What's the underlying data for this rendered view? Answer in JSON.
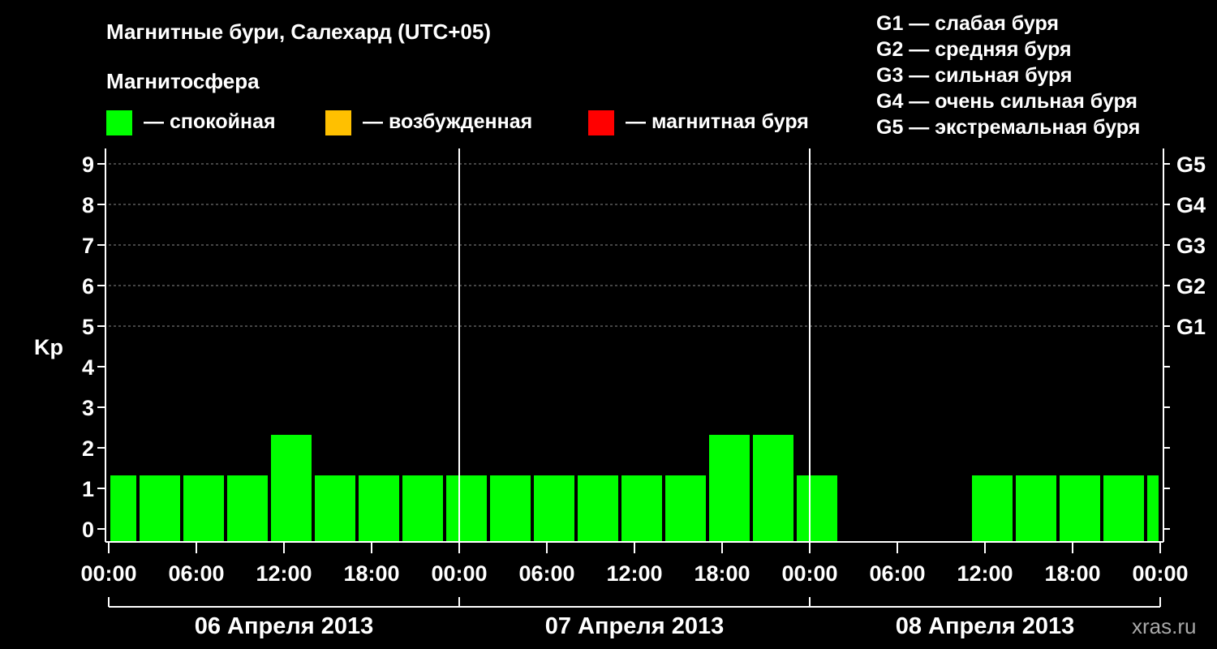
{
  "title": "Магнитные бури, Салехард (UTC+05)",
  "legend": {
    "heading": "Магнитосфера",
    "items": [
      {
        "key": "quiet",
        "label": "— спокойная",
        "color": "#00ff00"
      },
      {
        "key": "disturbed",
        "label": "— возбужденная",
        "color": "#ffc000"
      },
      {
        "key": "storm",
        "label": "— магнитная буря",
        "color": "#ff0000"
      }
    ]
  },
  "g_scale": [
    {
      "level": "G1",
      "text": "G1 — слабая буря"
    },
    {
      "level": "G2",
      "text": "G2 — средняя буря"
    },
    {
      "level": "G3",
      "text": "G3 — сильная буря"
    },
    {
      "level": "G4",
      "text": "G4 — очень сильная буря"
    },
    {
      "level": "G5",
      "text": "G5 — экстремальная буря"
    }
  ],
  "source": "xras.ru",
  "chart_data": {
    "type": "bar",
    "ylabel": "Kp",
    "ylim": [
      0,
      9
    ],
    "yticks": [
      0,
      1,
      2,
      3,
      4,
      5,
      6,
      7,
      8,
      9
    ],
    "right_ticks": [
      {
        "kp": 5,
        "label": "G1"
      },
      {
        "kp": 6,
        "label": "G2"
      },
      {
        "kp": 7,
        "label": "G3"
      },
      {
        "kp": 8,
        "label": "G4"
      },
      {
        "kp": 9,
        "label": "G5"
      }
    ],
    "x_hours_range": [
      0,
      72
    ],
    "xtick_hours": [
      0,
      6,
      12,
      18,
      24,
      30,
      36,
      42,
      48,
      54,
      60,
      66,
      72
    ],
    "xtick_labels": [
      "00:00",
      "06:00",
      "12:00",
      "18:00",
      "00:00",
      "06:00",
      "12:00",
      "18:00",
      "00:00",
      "06:00",
      "12:00",
      "18:00",
      "00:00"
    ],
    "days": [
      {
        "label": "06 Апреля 2013",
        "start_hour": 0
      },
      {
        "label": "07 Апреля 2013",
        "start_hour": 24
      },
      {
        "label": "08 Апреля 2013",
        "start_hour": 48
      }
    ],
    "grid": "dashed horizontal at Kp 5-9",
    "bars": [
      {
        "start_hour": 0,
        "end_hour": 2,
        "kp": 1,
        "state": "quiet"
      },
      {
        "start_hour": 2,
        "end_hour": 5,
        "kp": 1,
        "state": "quiet"
      },
      {
        "start_hour": 5,
        "end_hour": 8,
        "kp": 1,
        "state": "quiet"
      },
      {
        "start_hour": 8,
        "end_hour": 11,
        "kp": 1,
        "state": "quiet"
      },
      {
        "start_hour": 11,
        "end_hour": 14,
        "kp": 2,
        "state": "quiet"
      },
      {
        "start_hour": 14,
        "end_hour": 17,
        "kp": 1,
        "state": "quiet"
      },
      {
        "start_hour": 17,
        "end_hour": 20,
        "kp": 1,
        "state": "quiet"
      },
      {
        "start_hour": 20,
        "end_hour": 23,
        "kp": 1,
        "state": "quiet"
      },
      {
        "start_hour": 23,
        "end_hour": 26,
        "kp": 1,
        "state": "quiet"
      },
      {
        "start_hour": 26,
        "end_hour": 29,
        "kp": 1,
        "state": "quiet"
      },
      {
        "start_hour": 29,
        "end_hour": 32,
        "kp": 1,
        "state": "quiet"
      },
      {
        "start_hour": 32,
        "end_hour": 35,
        "kp": 1,
        "state": "quiet"
      },
      {
        "start_hour": 35,
        "end_hour": 38,
        "kp": 1,
        "state": "quiet"
      },
      {
        "start_hour": 38,
        "end_hour": 41,
        "kp": 1,
        "state": "quiet"
      },
      {
        "start_hour": 41,
        "end_hour": 44,
        "kp": 2,
        "state": "quiet"
      },
      {
        "start_hour": 44,
        "end_hour": 47,
        "kp": 2,
        "state": "quiet"
      },
      {
        "start_hour": 47,
        "end_hour": 50,
        "kp": 1,
        "state": "quiet"
      },
      {
        "start_hour": 59,
        "end_hour": 62,
        "kp": 1,
        "state": "quiet"
      },
      {
        "start_hour": 62,
        "end_hour": 65,
        "kp": 1,
        "state": "quiet"
      },
      {
        "start_hour": 65,
        "end_hour": 68,
        "kp": 1,
        "state": "quiet"
      },
      {
        "start_hour": 68,
        "end_hour": 71,
        "kp": 1,
        "state": "quiet"
      },
      {
        "start_hour": 71,
        "end_hour": 72,
        "kp": 1,
        "state": "quiet"
      }
    ]
  }
}
